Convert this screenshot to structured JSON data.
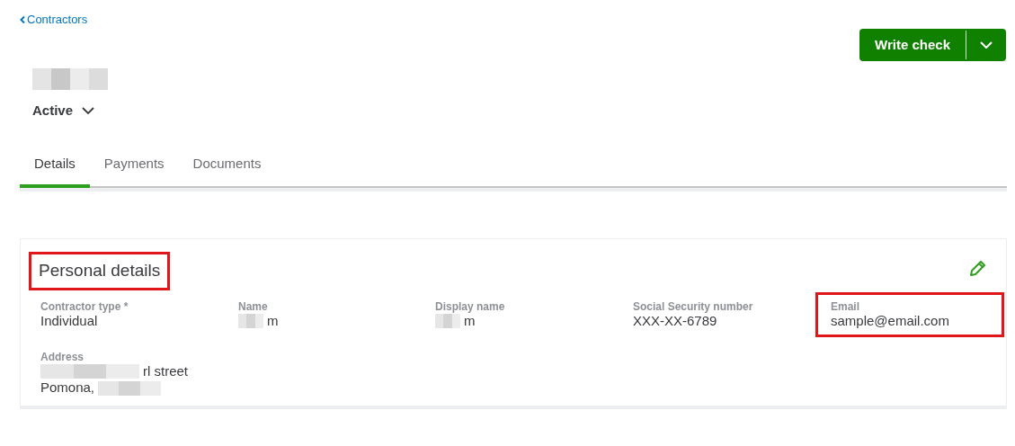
{
  "back_link": "Contractors",
  "primary_action": {
    "label": "Write check"
  },
  "contractor": {
    "name_redacted": true,
    "status": "Active"
  },
  "tabs": [
    {
      "label": "Details",
      "selected": true
    },
    {
      "label": "Payments",
      "selected": false
    },
    {
      "label": "Documents",
      "selected": false
    }
  ],
  "section": {
    "title": "Personal details",
    "highlighted": true,
    "fields": [
      {
        "label": "Contractor type *",
        "lines": [
          "Individual"
        ],
        "redacted": false,
        "highlighted": false
      },
      {
        "label": "Name",
        "lines": [
          "m"
        ],
        "redacted": true,
        "highlighted": false
      },
      {
        "label": "Display name",
        "lines": [
          "m"
        ],
        "redacted": true,
        "highlighted": false
      },
      {
        "label": "Social Security number",
        "lines": [
          "XXX-XX-6789"
        ],
        "redacted": false,
        "highlighted": false
      },
      {
        "label": "Email",
        "lines": [
          "sample@email.com"
        ],
        "redacted": false,
        "highlighted": true
      },
      {
        "label": "Address",
        "lines": [
          "rl street",
          "Pomona,"
        ],
        "redacted": true,
        "highlighted": false
      }
    ]
  }
}
